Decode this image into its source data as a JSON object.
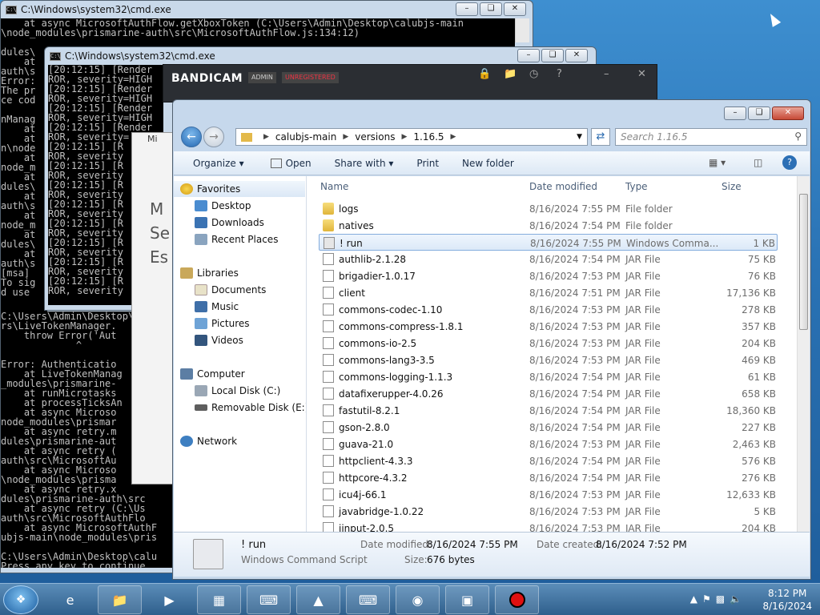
{
  "cmd1": {
    "title": "C:\\Windows\\system32\\cmd.exe",
    "top_lines": [
      "    at async MicrosoftAuthFlow.getXboxToken (C:\\Users\\Admin\\Desktop\\calubjs-main",
      "\\node_modules\\prismarine-auth\\src\\MicrosoftAuthFlow.js:134:12)"
    ],
    "left_lines": [
      "dules\\",
      "    at",
      "auth\\s",
      "Error:",
      "The pr",
      "ce cod",
      "      ",
      "nManag",
      "    at",
      "    at",
      "n\\node",
      "    at",
      "node_m",
      "    at",
      "dules\\",
      "    at",
      "auth\\s",
      "    at",
      "node_m",
      "    at",
      "dules\\",
      "    at",
      "auth\\s",
      "[msa]",
      "To sig",
      "d use"
    ],
    "bottom_lines": [
      "C:\\Users\\Admin\\Desktop\\calubjs-main\\node_modules\\prismarine-auth\\src\\TokenManagers\\",
      "rs\\LiveTokenManager.",
      "    throw Error('Aut",
      "             ^",
      "",
      "Error: Authenticatio",
      "    at LiveTokenManag",
      "_modules\\prismarine-",
      "    at runMicrotasks",
      "    at processTicksAn",
      "    at async Microso",
      "node_modules\\prismar",
      "    at async retry.m",
      "dules\\prismarine-aut",
      "    at async retry (",
      "auth\\src\\MicrosoftAu",
      "    at async Microso",
      "\\node_modules\\prisma",
      "    at async retry.x",
      "dules\\prismarine-auth\\src",
      "    at async retry (C:\\Us",
      "auth\\src\\MicrosoftAuthFlo",
      "    at async MicrosoftAuthF",
      "ubjs-main\\node_modules\\pris",
      "",
      "C:\\Users\\Admin\\Desktop\\calu",
      "Press any key to continue . . ."
    ]
  },
  "cmd2": {
    "title": "C:\\Windows\\system32\\cmd.exe",
    "lines": [
      "[20:12:15] [Render",
      "ROR, severity=HIGH",
      "[20:12:15] [Render",
      "ROR, severity=HIGH",
      "[20:12:15] [Render",
      "ROR, severity=HIGH",
      "[20:12:15] [Render",
      "ROR, severity=",
      "[20:12:15] [R",
      "ROR, severity",
      "[20:12:15] [R",
      "ROR, severity",
      "[20:12:15] [R",
      "ROR, severity",
      "[20:12:15] [R",
      "ROR, severity",
      "[20:12:15] [R",
      "ROR, severity",
      "[20:12:15] [R",
      "ROR, severity",
      "[20:12:15] [R",
      "ROR, severity",
      "[20:12:15] [R",
      "ROR, severity"
    ]
  },
  "ghost": {
    "title": "Mi",
    "lines": [
      "M",
      "Se",
      "Es"
    ]
  },
  "bandicam": {
    "logo": "BANDICAM",
    "badge1": "ADMIN",
    "badge2": "UNREGISTERED"
  },
  "explorer": {
    "path": [
      "calubjs-main",
      "versions",
      "1.16.5"
    ],
    "search_placeholder": "Search 1.16.5",
    "toolbar": {
      "organize": "Organize",
      "open": "Open",
      "share": "Share with",
      "print": "Print",
      "new_folder": "New folder"
    },
    "nav": {
      "favorites": "Favorites",
      "desktop": "Desktop",
      "downloads": "Downloads",
      "recent": "Recent Places",
      "libraries": "Libraries",
      "documents": "Documents",
      "music": "Music",
      "pictures": "Pictures",
      "videos": "Videos",
      "computer": "Computer",
      "local_disk": "Local Disk (C:)",
      "removable": "Removable Disk (E:)",
      "network": "Network"
    },
    "columns": {
      "name": "Name",
      "date": "Date modified",
      "type": "Type",
      "size": "Size"
    },
    "files": [
      {
        "name": "logs",
        "date": "8/16/2024 7:55 PM",
        "type": "File folder",
        "size": "",
        "kind": "folder"
      },
      {
        "name": "natives",
        "date": "8/16/2024 7:54 PM",
        "type": "File folder",
        "size": "",
        "kind": "folder"
      },
      {
        "name": "! run",
        "date": "8/16/2024 7:55 PM",
        "type": "Windows Comma...",
        "size": "1 KB",
        "kind": "bat"
      },
      {
        "name": "authlib-2.1.28",
        "date": "8/16/2024 7:54 PM",
        "type": "JAR File",
        "size": "75 KB",
        "kind": "jar"
      },
      {
        "name": "brigadier-1.0.17",
        "date": "8/16/2024 7:53 PM",
        "type": "JAR File",
        "size": "76 KB",
        "kind": "jar"
      },
      {
        "name": "client",
        "date": "8/16/2024 7:51 PM",
        "type": "JAR File",
        "size": "17,136 KB",
        "kind": "jar"
      },
      {
        "name": "commons-codec-1.10",
        "date": "8/16/2024 7:53 PM",
        "type": "JAR File",
        "size": "278 KB",
        "kind": "jar"
      },
      {
        "name": "commons-compress-1.8.1",
        "date": "8/16/2024 7:53 PM",
        "type": "JAR File",
        "size": "357 KB",
        "kind": "jar"
      },
      {
        "name": "commons-io-2.5",
        "date": "8/16/2024 7:53 PM",
        "type": "JAR File",
        "size": "204 KB",
        "kind": "jar"
      },
      {
        "name": "commons-lang3-3.5",
        "date": "8/16/2024 7:53 PM",
        "type": "JAR File",
        "size": "469 KB",
        "kind": "jar"
      },
      {
        "name": "commons-logging-1.1.3",
        "date": "8/16/2024 7:54 PM",
        "type": "JAR File",
        "size": "61 KB",
        "kind": "jar"
      },
      {
        "name": "datafixerupper-4.0.26",
        "date": "8/16/2024 7:54 PM",
        "type": "JAR File",
        "size": "658 KB",
        "kind": "jar"
      },
      {
        "name": "fastutil-8.2.1",
        "date": "8/16/2024 7:54 PM",
        "type": "JAR File",
        "size": "18,360 KB",
        "kind": "jar"
      },
      {
        "name": "gson-2.8.0",
        "date": "8/16/2024 7:54 PM",
        "type": "JAR File",
        "size": "227 KB",
        "kind": "jar"
      },
      {
        "name": "guava-21.0",
        "date": "8/16/2024 7:53 PM",
        "type": "JAR File",
        "size": "2,463 KB",
        "kind": "jar"
      },
      {
        "name": "httpclient-4.3.3",
        "date": "8/16/2024 7:54 PM",
        "type": "JAR File",
        "size": "576 KB",
        "kind": "jar"
      },
      {
        "name": "httpcore-4.3.2",
        "date": "8/16/2024 7:54 PM",
        "type": "JAR File",
        "size": "276 KB",
        "kind": "jar"
      },
      {
        "name": "icu4j-66.1",
        "date": "8/16/2024 7:53 PM",
        "type": "JAR File",
        "size": "12,633 KB",
        "kind": "jar"
      },
      {
        "name": "javabridge-1.0.22",
        "date": "8/16/2024 7:53 PM",
        "type": "JAR File",
        "size": "5 KB",
        "kind": "jar"
      },
      {
        "name": "jinput-2.0.5",
        "date": "8/16/2024 7:53 PM",
        "type": "JAR File",
        "size": "204 KB",
        "kind": "jar"
      }
    ],
    "selected_index": 2,
    "details": {
      "name": "! run",
      "type": "Windows Command Script",
      "date_modified_label": "Date modified:",
      "date_modified": "8/16/2024 7:55 PM",
      "date_created_label": "Date created:",
      "date_created": "8/16/2024 7:52 PM",
      "size_label": "Size:",
      "size": "676 bytes"
    }
  },
  "tray": {
    "time": "8:12 PM",
    "date": "8/16/2024"
  }
}
